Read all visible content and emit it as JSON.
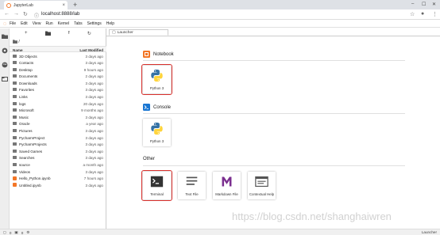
{
  "browser": {
    "tab_title": "JupyterLab",
    "new_tab": "+",
    "url_info": "ⓘ",
    "url": "localhost:8888/lab"
  },
  "menubar": {
    "items": [
      "File",
      "Edit",
      "View",
      "Run",
      "Kernel",
      "Tabs",
      "Settings",
      "Help"
    ]
  },
  "filebrowser": {
    "path": "/",
    "col_name": "Name",
    "col_modified": "Last Modified",
    "items": [
      {
        "name": "3D Objects",
        "modified": "3 days ago",
        "type": "folder"
      },
      {
        "name": "Contacts",
        "modified": "3 days ago",
        "type": "folder"
      },
      {
        "name": "Desktop",
        "modified": "9 hours ago",
        "type": "folder"
      },
      {
        "name": "Documents",
        "modified": "2 days ago",
        "type": "folder"
      },
      {
        "name": "Downloads",
        "modified": "3 days ago",
        "type": "folder"
      },
      {
        "name": "Favorites",
        "modified": "3 days ago",
        "type": "folder"
      },
      {
        "name": "Links",
        "modified": "3 days ago",
        "type": "folder"
      },
      {
        "name": "logs",
        "modified": "20 days ago",
        "type": "folder"
      },
      {
        "name": "Microsoft",
        "modified": "9 months ago",
        "type": "folder"
      },
      {
        "name": "Music",
        "modified": "3 days ago",
        "type": "folder"
      },
      {
        "name": "Oracle",
        "modified": "a year ago",
        "type": "folder"
      },
      {
        "name": "Pictures",
        "modified": "3 days ago",
        "type": "folder"
      },
      {
        "name": "PycharmProject",
        "modified": "3 days ago",
        "type": "folder"
      },
      {
        "name": "PycharmProjects",
        "modified": "3 days ago",
        "type": "folder"
      },
      {
        "name": "Saved Games",
        "modified": "3 days ago",
        "type": "folder"
      },
      {
        "name": "Searches",
        "modified": "3 days ago",
        "type": "folder"
      },
      {
        "name": "source",
        "modified": "a month ago",
        "type": "folder"
      },
      {
        "name": "Videos",
        "modified": "3 days ago",
        "type": "folder"
      },
      {
        "name": "Hello_Python.ipynb",
        "modified": "7 hours ago",
        "type": "notebook"
      },
      {
        "name": "Untitled.ipynb",
        "modified": "3 days ago",
        "type": "notebook"
      }
    ]
  },
  "main": {
    "tab_label": "Launcher",
    "sections": {
      "notebook": "Notebook",
      "console": "Console",
      "other": "Other"
    },
    "cards": {
      "notebook_python": "Python 3",
      "console_python": "Python 3",
      "terminal": "Terminal",
      "text_file": "Text File",
      "markdown_file": "Markdown File",
      "contextual_help": "Contextual Help"
    }
  },
  "statusbar": {
    "mode_count_a": "0",
    "mode_count_b": "0",
    "right": "Launcher"
  },
  "watermark": "https://blog.csdn.net/shanghaiwren",
  "colors": {
    "jupyter_orange": "#f37626",
    "highlight_red": "#d9302c",
    "python_blue": "#3572a5",
    "python_yellow": "#ffd43b",
    "markdown_purple": "#7b2f8f"
  }
}
